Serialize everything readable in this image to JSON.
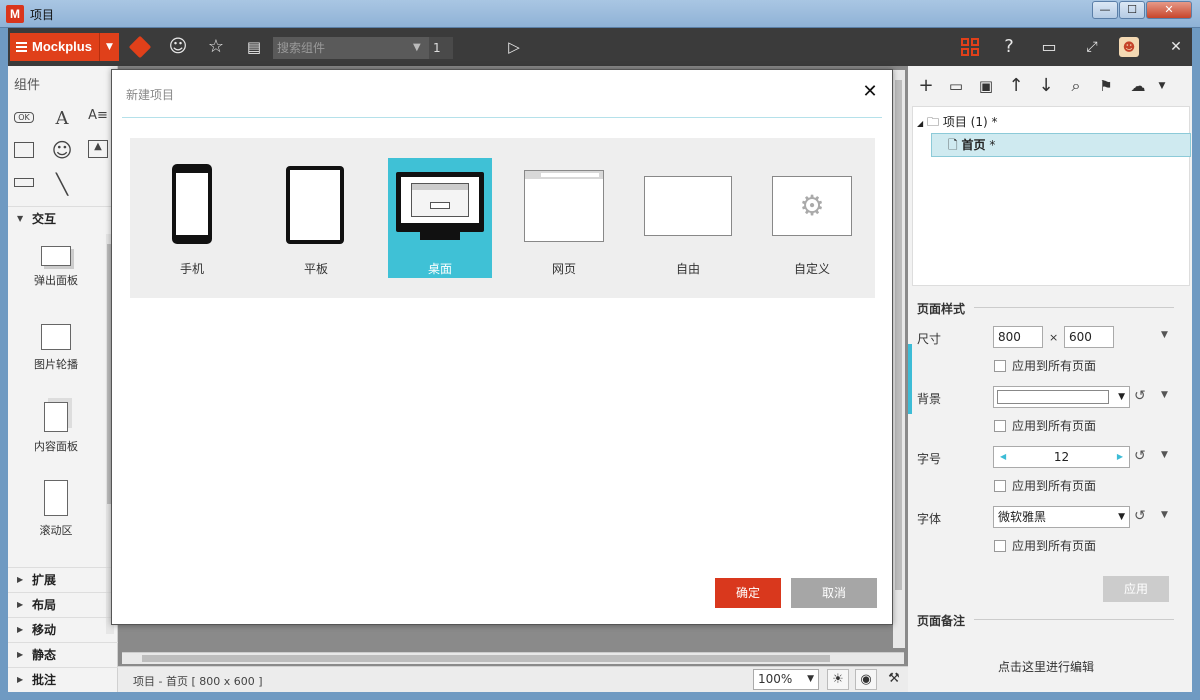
{
  "window": {
    "title": "项目",
    "app_icon": "M",
    "min": "—",
    "max": "☐",
    "close": "✕"
  },
  "toolbar": {
    "brand": "Mockplus",
    "search_placeholder": "搜索组件",
    "page_num": "1"
  },
  "left_panel": {
    "title": "组件",
    "interact_section": "交互",
    "items": [
      "弹出面板",
      "图片轮播",
      "内容面板",
      "滚动区"
    ],
    "sections": [
      "扩展",
      "布局",
      "移动",
      "静态",
      "批注"
    ],
    "ok_icon_text": "OK"
  },
  "status": {
    "text": "项目 - 首页 [ 800 x 600 ]",
    "zoom": "100%"
  },
  "right_panel": {
    "tree": {
      "root": "项目 (1)",
      "root_mark": "*",
      "page": "首页",
      "page_mark": "*"
    },
    "page_style": "页面样式",
    "size_label": "尺寸",
    "width": "800",
    "x": "×",
    "height": "600",
    "apply_all": "应用到所有页面",
    "bg_label": "背景",
    "font_size_label": "字号",
    "font_size": "12",
    "font_label": "字体",
    "font": "微软雅黑",
    "apply": "应用",
    "notes_title": "页面备注",
    "notes_hint": "点击这里进行编辑"
  },
  "dialog": {
    "title": "新建项目",
    "types": [
      "手机",
      "平板",
      "桌面",
      "网页",
      "自由",
      "自定义"
    ],
    "active_type": "桌面",
    "ok": "确定",
    "cancel": "取消"
  },
  "colors": {
    "accent": "#e0401a",
    "selected": "#3fc1d6",
    "ok": "#d9381d"
  }
}
